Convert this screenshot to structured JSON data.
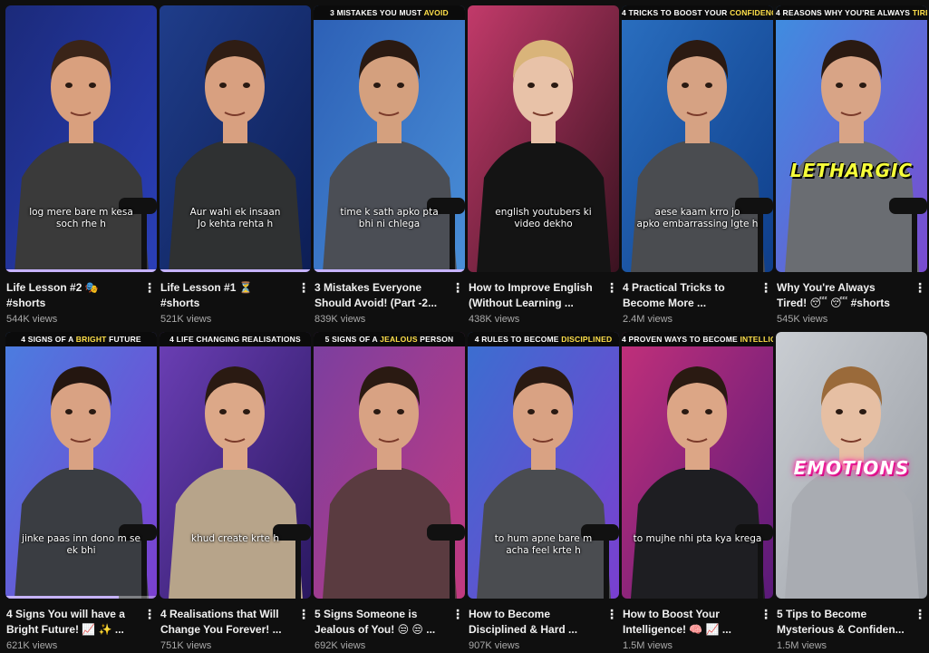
{
  "shorts": [
    {
      "title": "Life Lesson #2 🎭 #shorts",
      "views": "544K views",
      "banner_pre": "",
      "banner_hl": "",
      "banner_post": "",
      "caption_l1": "log mere bare m kesa",
      "caption_l2": "soch rhe h",
      "big_word": "",
      "bg_top": "#1b2a7a",
      "bg_bottom": "#2a3fb8",
      "shirt": "#3a3a3a",
      "skin": "#d9a07e",
      "hair": "#3a2418",
      "mic": true,
      "progress": 1.0
    },
    {
      "title": "Life Lesson #1 ⏳ #shorts",
      "views": "521K views",
      "banner_pre": "",
      "banner_hl": "",
      "banner_post": "",
      "caption_l1": "Aur wahi ek insaan",
      "caption_l2": "Jo kehta rehta h",
      "big_word": "",
      "bg_top": "#1f3d8a",
      "bg_bottom": "#0d1e55",
      "shirt": "#2f3132",
      "skin": "#d8a080",
      "hair": "#2f1d14",
      "mic": false,
      "progress": 1.0
    },
    {
      "title": "3 Mistakes Everyone Should Avoid! (Part -2...",
      "views": "839K views",
      "banner_pre": "3 Mistakes you must",
      "banner_hl": "avoid",
      "banner_post": "",
      "caption_l1": "time k sath apko pta",
      "caption_l2": "bhi ni chlega",
      "big_word": "",
      "bg_top": "#2c5fb5",
      "bg_bottom": "#4a8fd8",
      "shirt": "#4b4e55",
      "skin": "#d4a07e",
      "hair": "#2a1a12",
      "mic": true,
      "progress": 1.0
    },
    {
      "title": "How to Improve English (Without Learning ...",
      "views": "438K views",
      "banner_pre": "",
      "banner_hl": "",
      "banner_post": "",
      "caption_l1": "english youtubers ki",
      "caption_l2": "video dekho",
      "big_word": "",
      "bg_top": "#c23a6a",
      "bg_bottom": "#3a1220",
      "shirt": "#141414",
      "skin": "#e8c2a8",
      "hair": "#d9b47a",
      "mic": false,
      "progress": 0
    },
    {
      "title": "4 Practical Tricks to Become More ...",
      "views": "2.4M views",
      "banner_pre": "4 Tricks to boost your",
      "banner_hl": "confidence",
      "banner_post": "",
      "caption_l1": "aese kaam krro jo",
      "caption_l2": "apko embarrassing lgte h",
      "big_word": "",
      "bg_top": "#2a6fc0",
      "bg_bottom": "#0f3e8a",
      "shirt": "#4a4c50",
      "skin": "#d6a283",
      "hair": "#2b1a12",
      "mic": true,
      "progress": 0
    },
    {
      "title": "Why You're Always Tired! 😴 😴 #shorts",
      "views": "545K views",
      "banner_pre": "4 Reasons why you're always",
      "banner_hl": "tired",
      "banner_post": "",
      "caption_l1": "",
      "caption_l2": "",
      "big_word": "LETHARGIC",
      "bg_top": "#3e8ee0",
      "bg_bottom": "#7a4bd0",
      "shirt": "#6a6d72",
      "skin": "#d8a486",
      "hair": "#2a1a12",
      "mic": true,
      "progress": 0
    },
    {
      "title": "4 Signs You will have a Bright Future! 📈 ✨ ...",
      "views": "621K views",
      "banner_pre": "4 Signs of a",
      "banner_hl": "bright",
      "banner_post": "future",
      "caption_l1": "jinke paas inn dono m se",
      "caption_l2": "ek bhi",
      "big_word": "",
      "bg_top": "#4a7ee0",
      "bg_bottom": "#7b3fd0",
      "shirt": "#3a3d42",
      "skin": "#d9a283",
      "hair": "#241610",
      "mic": true,
      "progress": 0.75
    },
    {
      "title": "4 Realisations that Will Change You Forever! ...",
      "views": "751K views",
      "banner_pre": "4 Life changing realisations",
      "banner_hl": "",
      "banner_post": "",
      "caption_l1": "khud create krte h",
      "caption_l2": "",
      "big_word": "",
      "bg_top": "#6b3fb5",
      "bg_bottom": "#2a1860",
      "shirt": "#b7a48a",
      "skin": "#dca888",
      "hair": "#2a1a12",
      "mic": true,
      "progress": 0
    },
    {
      "title": "5 Signs Someone is Jealous of You! 😒 😒 ...",
      "views": "692K views",
      "banner_pre": "5 Signs of a",
      "banner_hl": "jealous",
      "banner_post": "person",
      "caption_l1": "",
      "caption_l2": "",
      "big_word": "",
      "bg_top": "#7a3fa0",
      "bg_bottom": "#c23a80",
      "shirt": "#5a3b40",
      "skin": "#d8a283",
      "hair": "#2a1a12",
      "mic": true,
      "progress": 0
    },
    {
      "title": "How to Become Disciplined & Hard ...",
      "views": "907K views",
      "banner_pre": "4 Rules to become",
      "banner_hl": "disciplined",
      "banner_post": "",
      "caption_l1": "to hum apne bare m",
      "caption_l2": "acha feel krte h",
      "big_word": "",
      "bg_top": "#3a6fd0",
      "bg_bottom": "#7a3fd0",
      "shirt": "#4a4c50",
      "skin": "#d9a283",
      "hair": "#2a1a12",
      "mic": true,
      "progress": 0
    },
    {
      "title": "How to Boost Your Intelligence! 🧠 📈 ...",
      "views": "1.5M views",
      "banner_pre": "4 Proven ways to become",
      "banner_hl": "intelligent",
      "banner_post": "",
      "caption_l1": "to mujhe nhi pta kya krega",
      "caption_l2": "",
      "big_word": "",
      "bg_top": "#c2307a",
      "bg_bottom": "#5a1a7a",
      "shirt": "#1e1e22",
      "skin": "#dca686",
      "hair": "#2a1a12",
      "mic": true,
      "progress": 0
    },
    {
      "title": "5 Tips to Become Mysterious & Confiden...",
      "views": "1.5M views",
      "banner_pre": "",
      "banner_hl": "",
      "banner_post": "",
      "caption_l1": "",
      "caption_l2": "",
      "big_word": "EMOTIONS",
      "bg_top": "#c9cdd2",
      "bg_bottom": "#9a9ea5",
      "shirt": "#a9acb2",
      "skin": "#e6bfa3",
      "hair": "#9a6a3a",
      "mic": false,
      "progress": 0
    }
  ],
  "menu_icon": "more-vert-icon"
}
